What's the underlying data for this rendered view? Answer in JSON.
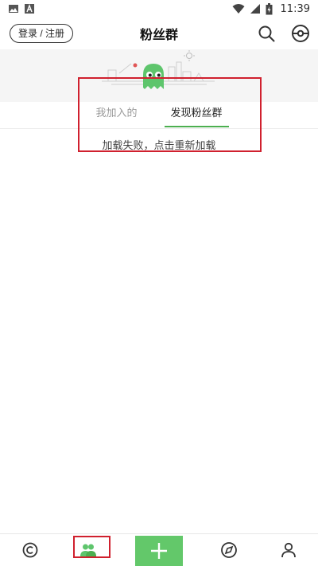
{
  "status_bar": {
    "time": "11:39"
  },
  "header": {
    "login_label": "登录 / 注册",
    "title": "粉丝群"
  },
  "tabs": [
    {
      "label": "我加入的"
    },
    {
      "label": "发现粉丝群"
    }
  ],
  "main": {
    "load_error": "加载失败，点击重新加载"
  },
  "bottom_nav": {
    "items": [
      {
        "icon": "home-c-icon"
      },
      {
        "icon": "fan-group-icon",
        "active": true
      },
      {
        "icon": "plus-icon"
      },
      {
        "icon": "discover-icon"
      },
      {
        "icon": "profile-icon"
      }
    ]
  },
  "colors": {
    "accent": "#4caf50",
    "add_button": "#63c86a",
    "highlight_box": "#d0202e"
  }
}
